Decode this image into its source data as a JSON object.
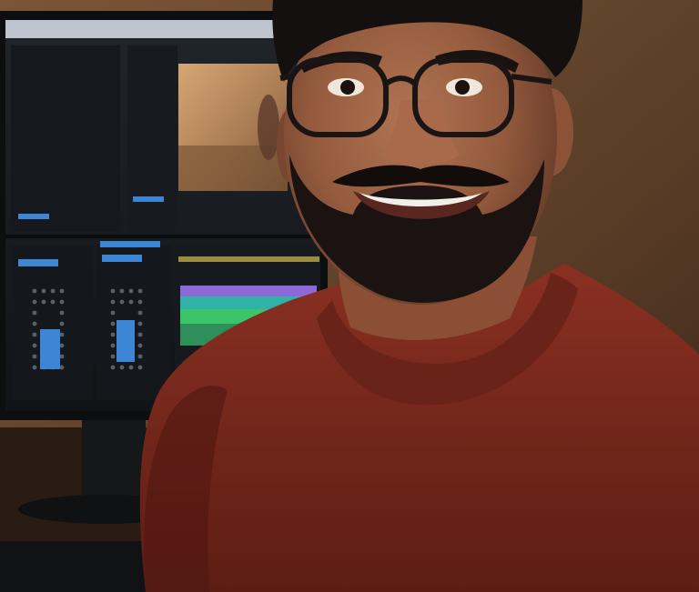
{
  "scene": {
    "description_visible": false,
    "colors": {
      "wall": "#6b4a30",
      "wall_dark": "#3d2a1c",
      "monitor_frame": "#121416",
      "monitor_panel": "#1b1f24",
      "ui_blue": "#3d86d6",
      "ui_green": "#3cc46a",
      "ui_purple": "#8b6ad8",
      "ui_teal": "#2fb3a7",
      "video_preview": "#b88a5e",
      "sweater": "#7b2a1c",
      "sweater_shadow": "#4e1710",
      "skin": "#9b6043",
      "skin_shadow": "#6f3f2a",
      "hair": "#151010",
      "beard": "#1b1311",
      "glasses": "#1a1414"
    },
    "icons": {
      "monitor": "monitor-icon",
      "person": "person-icon",
      "glasses": "glasses-icon"
    }
  }
}
